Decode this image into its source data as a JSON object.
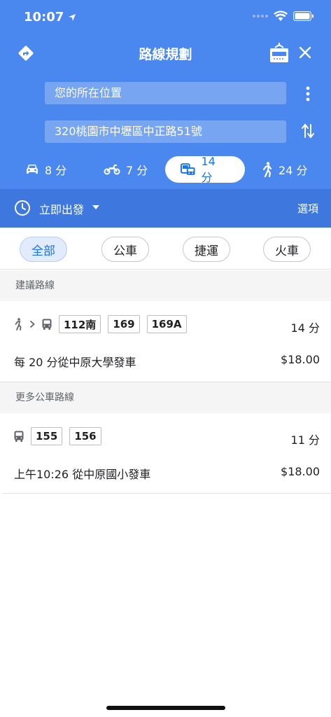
{
  "status": {
    "time": "10:07"
  },
  "header": {
    "title": "路線規劃",
    "origin": "您的所在位置",
    "destination": "320桃園市中壢區中正路51號"
  },
  "modes": [
    {
      "name": "car",
      "time": "8 分"
    },
    {
      "name": "motorcycle",
      "time": "7 分"
    },
    {
      "name": "transit",
      "time": "14 分"
    },
    {
      "name": "walk",
      "time": "24 分"
    }
  ],
  "depart": {
    "label": "立即出發",
    "options": "選項"
  },
  "filters": {
    "all": "全部",
    "bus": "公車",
    "metro": "捷運",
    "train": "火車"
  },
  "sections": {
    "suggested": "建議路線",
    "more_bus": "更多公車路線"
  },
  "routes": [
    {
      "lines": [
        "112南",
        "169",
        "169A"
      ],
      "duration": "14 分",
      "description": "每 20 分從中原大學發車",
      "fare": "$18.00"
    },
    {
      "lines": [
        "155",
        "156"
      ],
      "duration": "11 分",
      "description": "上午10:26 從中原國小發車",
      "fare": "$18.00"
    }
  ],
  "colors": {
    "header": "#4a87ee",
    "depart_bar": "#3e78de",
    "accent": "#1a73e8"
  }
}
